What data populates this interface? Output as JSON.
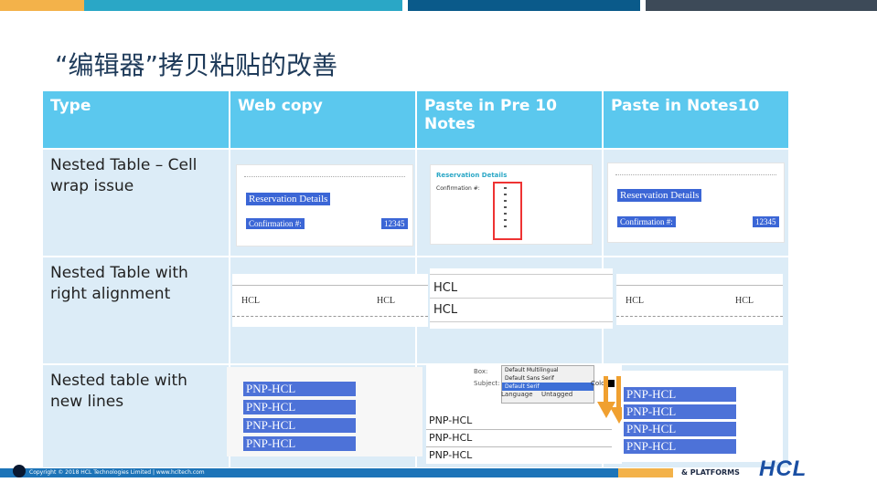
{
  "slide": {
    "title": "“编辑器”拷贝粘贴的改善"
  },
  "colors": {
    "header_blue": "#5bc8ee",
    "row_bg": "#dcecf7",
    "top_orange": "#f3b24a",
    "top_teal": "#2aa7c6",
    "top_navy": "#0a5a8a",
    "top_dark": "#3d4a58",
    "footer_blue": "#1d74b8",
    "footer_orange": "#f3b24a"
  },
  "table": {
    "headers": [
      "Type",
      "Web copy",
      "Paste in Pre 10 Notes",
      "Paste in Notes10"
    ],
    "rows": [
      {
        "type": "Nested Table – Cell wrap issue"
      },
      {
        "type": "Nested Table with right alignment"
      },
      {
        "type": "Nested table with new lines"
      }
    ]
  },
  "shots": {
    "row1": {
      "web_label": "Reservation Details",
      "web_field": "Confirmation #:",
      "web_value": "12345",
      "pre_label": "Reservation Details",
      "pre_field": "Confirmation #:",
      "n10_label": "Reservation Details",
      "n10_field": "Confirmation #:",
      "n10_value": "12345"
    },
    "row2": {
      "hcl": "HCL"
    },
    "row3": {
      "pnp": "PNP-HCL",
      "menu": [
        "Default Multilingual",
        "Default Sans Serif",
        "Default Serif"
      ],
      "menu_lang_label": "Language",
      "menu_lang_value": "Untagged",
      "menu_box_label": "Box:",
      "menu_subject_label": "Subject:",
      "menu_color_label": "Color"
    }
  },
  "footer": {
    "copyright": "Copyright © 2018 HCL Technologies Limited  |  www.hcltech.com",
    "platforms": "& PLATFORMS",
    "logo": "HCL"
  }
}
